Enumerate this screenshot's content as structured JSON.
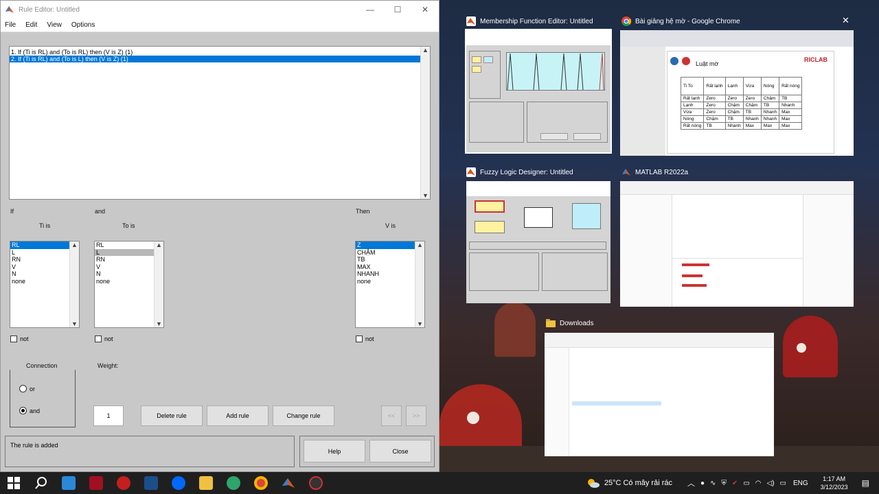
{
  "rule_editor": {
    "title": "Rule Editor: Untitled",
    "controls": {
      "minimize": "—",
      "maximize": "☐",
      "close": "✕"
    },
    "menu": [
      "File",
      "Edit",
      "View",
      "Options"
    ],
    "rules": [
      {
        "text": "1. If (Ti is RL) and (To is RL) then (V is Z) (1)",
        "selected": false
      },
      {
        "text": "2. If (Ti is RL) and (To is L) then (V is Z) (1)",
        "selected": true
      }
    ],
    "labels": {
      "if": "If",
      "and": "and",
      "then": "Then",
      "ti_is": "Ti is",
      "to_is": "To is",
      "v_is": "V is"
    },
    "ti_options": [
      "RL",
      "L",
      "RN",
      "V",
      "N",
      "none"
    ],
    "to_options": [
      "RL",
      "L",
      "RN",
      "V",
      "N",
      "none"
    ],
    "v_options": [
      "Z",
      "CHẬM",
      "TB",
      "MAX",
      "NHANH",
      "none"
    ],
    "not_label": "not",
    "connection": {
      "label": "Connection",
      "or": "or",
      "and": "and",
      "selected": "and"
    },
    "weight": {
      "label": "Weight:",
      "value": "1"
    },
    "buttons": {
      "delete": "Delete rule",
      "add": "Add rule",
      "change": "Change rule",
      "prev": "<<",
      "next": ">>",
      "help": "Help",
      "close": "Close"
    },
    "status": "The rule is added"
  },
  "task_view": [
    {
      "title": "Membership Function Editor: Untitled"
    },
    {
      "title": "Bài giảng hệ mờ - Google Chrome"
    },
    {
      "title": "Fuzzy Logic Designer: Untitled"
    },
    {
      "title": "MATLAB R2022a"
    },
    {
      "title": "Downloads"
    }
  ],
  "chrome_slide": {
    "heading": "Luật mờ",
    "logo": "RICLAB",
    "corner": "Ti  To",
    "columns": [
      "Rất lạnh",
      "Lạnh",
      "Vừa",
      "Nóng",
      "Rất nóng"
    ],
    "rows": [
      [
        "Rất lạnh",
        "Zero",
        "Zero",
        "Zero",
        "Chậm",
        "TB"
      ],
      [
        "Lạnh",
        "Zero",
        "Chậm",
        "Chậm",
        "TB",
        "Nhanh"
      ],
      [
        "Vừa",
        "Zero",
        "Chậm",
        "TB",
        "Nhanh",
        "Max"
      ],
      [
        "Nóng",
        "Chậm",
        "TB",
        "Nhanh",
        "Nhanh",
        "Max"
      ],
      [
        "Rất nóng",
        "TB",
        "Nhanh",
        "Max",
        "Max",
        "Max"
      ]
    ]
  },
  "taskbar": {
    "weather": "25°C  Có mây rải rác",
    "lang": "ENG",
    "time": "1:17 AM",
    "date": "3/12/2023"
  }
}
